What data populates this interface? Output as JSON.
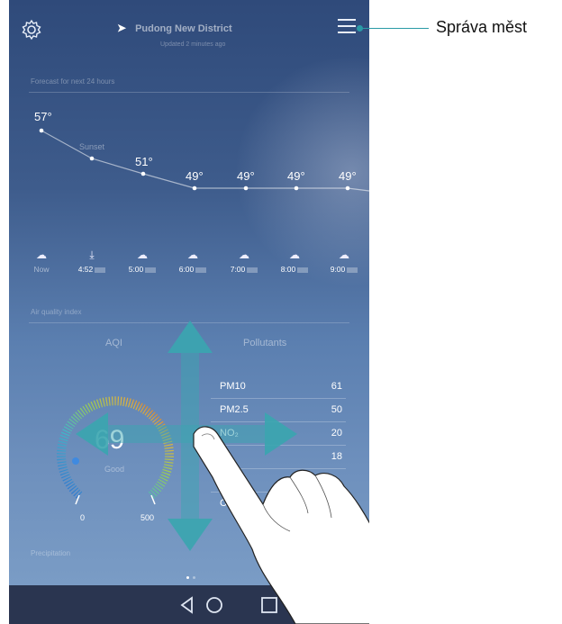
{
  "app": {
    "location": "Pudong New District",
    "updated": "Updated 2 minutes ago"
  },
  "forecast": {
    "title": "Forecast for next 24 hours",
    "sunset_label": "Sunset",
    "temps": [
      "57°",
      "51°",
      "49°",
      "49°",
      "49°",
      "49°"
    ],
    "hours": [
      {
        "time": "Now",
        "icon": "partly-cloudy-icon"
      },
      {
        "time": "4:52",
        "icon": "sunset-icon"
      },
      {
        "time": "5:00",
        "icon": "partly-cloudy-icon"
      },
      {
        "time": "6:00",
        "icon": "partly-cloudy-icon"
      },
      {
        "time": "7:00",
        "icon": "partly-cloudy-icon"
      },
      {
        "time": "8:00",
        "icon": "partly-cloudy-icon"
      },
      {
        "time": "9:00",
        "icon": "partly-cloudy-icon"
      }
    ]
  },
  "air_quality": {
    "title": "Air quality index",
    "tabs": [
      "AQI",
      "Pollutants"
    ],
    "aqi_value": "69",
    "aqi_level": "Good",
    "gauge_min": "0",
    "gauge_max": "500",
    "pollutants": [
      {
        "name": "PM10",
        "value": "61"
      },
      {
        "name": "PM2.5",
        "value": "50"
      },
      {
        "name": "NO₂",
        "value": "20"
      },
      {
        "name": "",
        "value": "18"
      },
      {
        "name": "O₃",
        "value": ""
      },
      {
        "name": "CO",
        "value": ""
      }
    ]
  },
  "precip_title": "Precipitation",
  "callout": "Správa měst",
  "colors": {
    "callout": "#2a9aa6",
    "arrow": "#3aa6b0"
  }
}
